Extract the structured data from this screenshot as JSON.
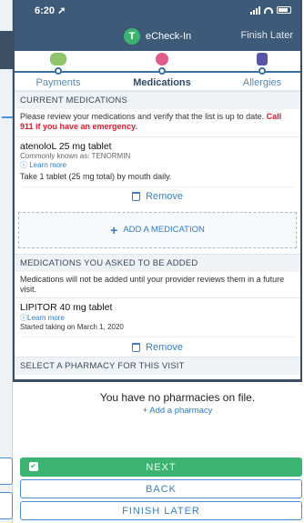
{
  "status": {
    "time": "6:20 ➚"
  },
  "nav": {
    "badge": "T",
    "title": "eCheck-In",
    "finish": "Finish Later"
  },
  "steps": [
    {
      "label": "Payments"
    },
    {
      "label": "Medications"
    },
    {
      "label": "Allergies"
    }
  ],
  "current": {
    "header": "CURRENT MEDICATIONS",
    "intro": "Please review your medications and verify that the list is up to date. ",
    "warning": "Call 911 if you have an emergency.",
    "med": {
      "name": "atenoloL 25 mg tablet",
      "known_as": "Commonly known as: TENORMIN",
      "learn_more": "ⓘ Learn more",
      "instructions": "Take 1 tablet (25 mg total) by mouth daily.",
      "remove": "Remove"
    },
    "add_label": "ADD A MEDICATION"
  },
  "requested": {
    "header": "MEDICATIONS YOU ASKED TO BE ADDED",
    "note": "Medications will not be added until your provider reviews them in a future visit.",
    "med": {
      "name": "LIPITOR 40 mg tablet",
      "learn_more": "ⓘLearn more",
      "started": "Started taking on March 1, 2020",
      "remove": "Remove"
    }
  },
  "pharmacy": {
    "header": "SELECT A PHARMACY FOR THIS VISIT",
    "empty": "You have no pharmacies on file.",
    "add": "+ Add a pharmacy"
  },
  "buttons": {
    "next": "NEXT",
    "back": "BACK",
    "later": "FINISH LATER"
  },
  "colors": {
    "header_blue": "#3d5a78",
    "accent": "#2f7bc7",
    "next_green": "#3cb371",
    "warning_red": "#d81b2c"
  }
}
